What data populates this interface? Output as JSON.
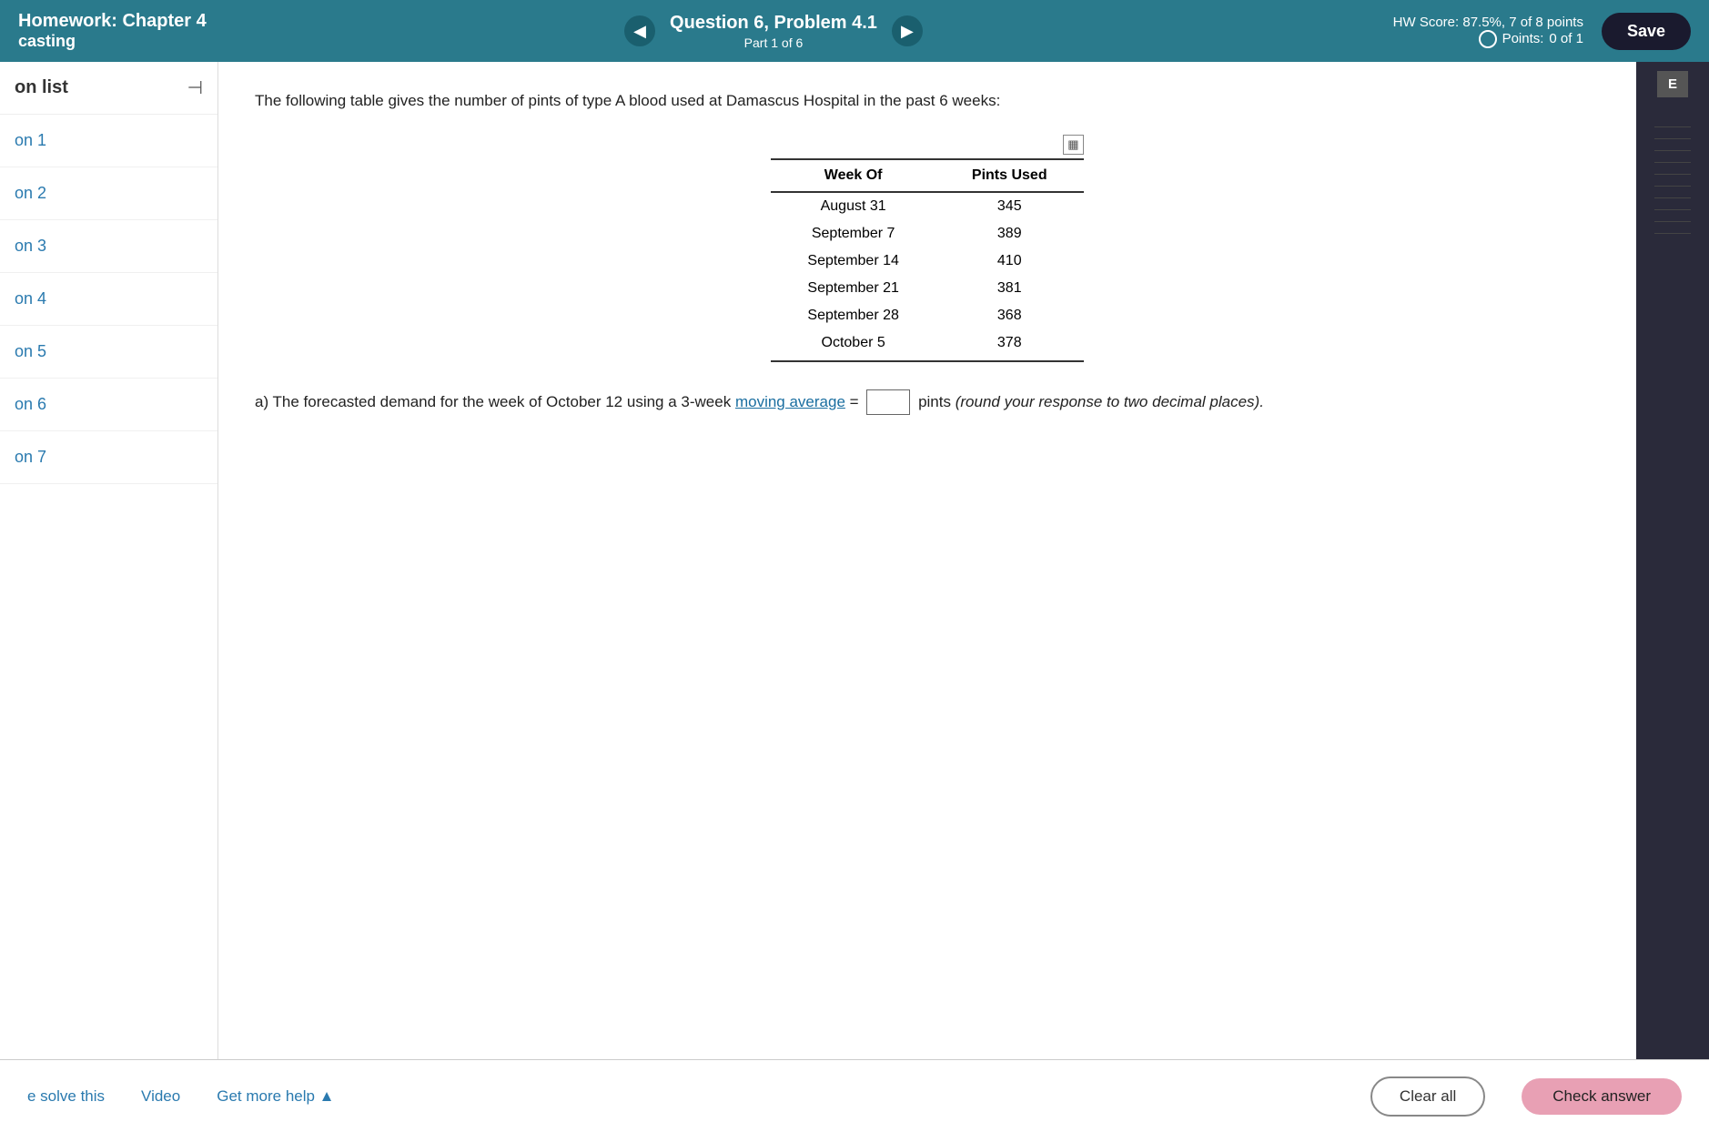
{
  "header": {
    "chapter": "Chapter 4",
    "casting": "casting",
    "question_title": "Question 6, Problem 4.1",
    "part": "Part 1 of 6",
    "hw_score_label": "HW Score:",
    "hw_score_value": "87.5%, 7 of 8 points",
    "points_label": "Points:",
    "points_value": "0 of 1",
    "save_label": "Save",
    "prev_icon": "◀",
    "next_icon": "▶"
  },
  "sidebar": {
    "title": "on list",
    "collapse_icon": "⊣",
    "items": [
      {
        "label": "on 1"
      },
      {
        "label": "on 2"
      },
      {
        "label": "on 3"
      },
      {
        "label": "on 4"
      },
      {
        "label": "on 5"
      },
      {
        "label": "on 6"
      },
      {
        "label": "on 7"
      }
    ]
  },
  "right_panel": {
    "label": "E"
  },
  "problem": {
    "description": "The following table gives the number of pints of type A blood used at Damascus Hospital in the past 6 weeks:",
    "table": {
      "col1": "Week Of",
      "col2": "Pints Used",
      "rows": [
        {
          "week": "August 31",
          "pints": "345"
        },
        {
          "week": "September 7",
          "pints": "389"
        },
        {
          "week": "September 14",
          "pints": "410"
        },
        {
          "week": "September 21",
          "pints": "381"
        },
        {
          "week": "September 28",
          "pints": "368"
        },
        {
          "week": "October 5",
          "pints": "378"
        }
      ]
    },
    "part_a_prefix": "a) The forecasted demand for the week of October 12 using a 3-week",
    "moving_average_link": "moving average",
    "part_a_equals": "=",
    "part_a_suffix": "pints",
    "part_a_italic": "(round your response to two decimal places)."
  },
  "bottom": {
    "solve_this": "e solve this",
    "video": "Video",
    "get_more_help": "Get more help ▲",
    "clear_all": "Clear all",
    "check_answer": "Check answer"
  }
}
